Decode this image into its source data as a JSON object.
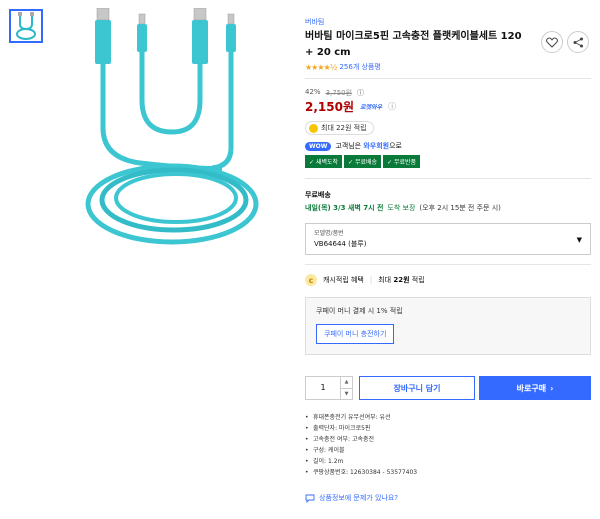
{
  "gallery": {
    "thumbnail_icon": "cable-thumbnail-icon",
    "photo_icon": "cable-photo"
  },
  "product": {
    "brand": "버바팀",
    "title": "버바팀 마이크로5핀 고속충전 플랫케이블세트 120 + 20 cm",
    "stars": "★★★★½",
    "rating_count": "256개 상품평",
    "accent_color": "#346aff"
  },
  "price": {
    "discount_rate": "42%",
    "original_price": "3,750원",
    "sale_price": "2,150원",
    "delivery_badge": "로켓와우",
    "reward": "최대 22원 적립",
    "price_color": "#ae0000"
  },
  "wow": {
    "badge": "WOW",
    "text_prefix": "고객님은 ",
    "member_link": "와우회원",
    "text_suffix": "으로",
    "benefits": [
      "새벽도착",
      "무료배송",
      "무료반품"
    ],
    "benefit_color": "#0a7a3a"
  },
  "shipping": {
    "label": "무료배송",
    "date": "내일(목) 3/3 새벽 7시 전",
    "guarantee": "도착 보장",
    "note": "(오후 2시 15분 전 주문 시)"
  },
  "option": {
    "label": "모델명/품번",
    "value": "VB64644 (블루)"
  },
  "cash": {
    "title": "캐시적립 혜택",
    "amount_prefix": "최대 ",
    "amount": "22원",
    "amount_suffix": " 적립"
  },
  "coupay": {
    "text": "쿠페이 머니 결제 시 1% 적립",
    "button": "쿠페이 머니 충전하기"
  },
  "purchase": {
    "quantity": "1",
    "cart_button": "장바구니 담기",
    "buy_button": "바로구매",
    "buy_arrow": "›"
  },
  "specs": [
    "휴대폰충전기 유무선여부: 유선",
    "출력단자: 마이크로5핀",
    "고속충전 여부: 고속충전",
    "구성: 케이블",
    "길이: 1.2m",
    "쿠팡상품번호: 12630384 - 53577403"
  ],
  "report": {
    "text": "상품정보에 문제가 있나요?"
  }
}
